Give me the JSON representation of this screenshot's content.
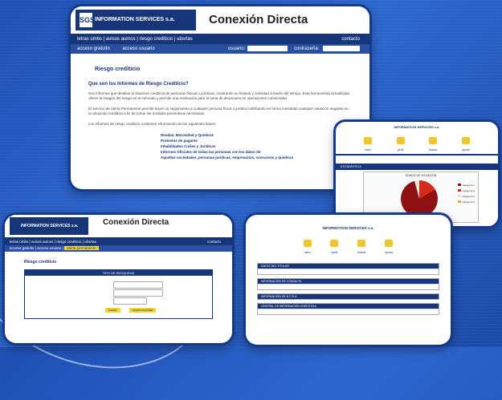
{
  "main_window": {
    "logo_text": "INFORMATION SERVICES s.a.",
    "logo_mark": "SGS",
    "brand_title": "Conexión Directa",
    "nav_items": [
      "letras úmbs",
      "avisos aumos",
      "riesgo crediticio",
      "ubsrtas"
    ],
    "nav_right": "contacto",
    "sub_items": [
      "acceso gratuito",
      "acceso usuario"
    ],
    "usuario_label": "usuario:",
    "password_label": "contraseña:",
    "section_title": "Riesgo crediticio",
    "question": "Que son los Informes de Riesgo Crediticio?",
    "paragraphs": [
      "Son informes que detallan la situación crediticia de personas físicas o jurídicas, mostrando su historia y actividad a través del tiempo. Esta herramienta actualizada ofrece la imagen del riesgo en el mercado y permite una evaluación para la toma de decisiones en operaciones comerciales.",
      "El servicio de Alerta Permanente permite hacer un seguimiento a cualquier persona física o jurídica notificando en forma inmediata cualquier variación negativa en su situación crediticia a fin de tomar las medidas preventivas necesarias.",
      "Los informes de riesgo crediticio contienen información de las siguientes bases:"
    ],
    "list_items": [
      "Deudas, Morosidad y Quiebras",
      "Protestos de pagarés",
      "Inhabilitados Civiles y Jurídicos",
      "Informes Oficiales de todas las personas con los datos de:",
      "Aquellas sociedades, personas jurídicas, empresarios, concursos y quiebras"
    ]
  },
  "chart_window": {
    "logo_text": "INFORMATION SERVICES s.a.",
    "icon_labels": [
      "inicio",
      "perfil",
      "buscar",
      "ayuda"
    ],
    "bar_text": "ESTADÍSTICA",
    "chart_title": "GRADO DE SITUACIÓN",
    "legend": [
      "Categoría 1",
      "Categoría 2",
      "Categoría 3",
      "Categoría 4"
    ],
    "colors": {
      "dark_red": "#8e1212",
      "red": "#d32a1a",
      "light": "#e8e2dc"
    }
  },
  "form_window": {
    "logo_text": "INFORMATION SERVICES s.a.",
    "logo_mark": "SGS",
    "brand_title": "Conexión Directa",
    "nav_items": [
      "letras úmbs",
      "avisos aumos",
      "riesgo crediticio",
      "ubsrtas"
    ],
    "nav_right": "contacto",
    "sub_items": [
      "acceso gratuito",
      "acceso usuario",
      "alerta permanente"
    ],
    "section_title": "Riesgo crediticio",
    "form_header": "TIPO DE BÚSQUEDA",
    "buttons": [
      "buscar",
      "ayuda consultas"
    ]
  },
  "dashboard_window": {
    "logo_text": "INFORMATION SERVICES s.a.",
    "icon_labels": [
      "inicio",
      "perfil",
      "buscar",
      "ayuda"
    ],
    "sections": [
      "DATOS DEL TITULAR",
      "INFORMACIÓN DE CONSULTA",
      "INFORMACIÓN DE B.C.R.A.",
      "CENTRAL DE INFORMACIÓN CREDITICIA"
    ]
  }
}
